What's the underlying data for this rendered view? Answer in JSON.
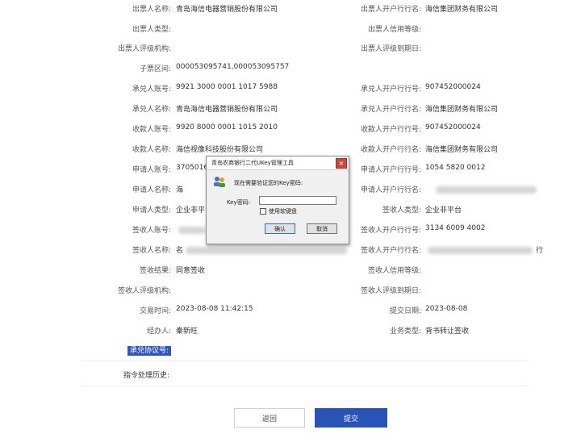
{
  "rows": [
    {
      "left_label": "出票人名称:",
      "left_value": "青岛海信电器营销股份有限公司",
      "right_label": "出票人开户行行名:",
      "right_value": "海信集团财务有限公司"
    },
    {
      "left_label": "出票人类型:",
      "left_value": "",
      "right_label": "出票人信用等级:",
      "right_value": ""
    },
    {
      "left_label": "出票人评级机构:",
      "left_value": "",
      "right_label": "出票人评级到期日:",
      "right_value": ""
    },
    {
      "left_label": "子票区间:",
      "left_value": "000053095741,000053095757",
      "right_label": "",
      "right_value": ""
    },
    {
      "left_label": "承兑人账号:",
      "left_value": "9921 3000 0001 1017 5988",
      "right_label": "承兑人开户行行号:",
      "right_value": "907452000024"
    },
    {
      "left_label": "承兑人名称:",
      "left_value": "青岛海信电器营销股份有限公司",
      "right_label": "承兑人开户行行名:",
      "right_value": "海信集团财务有限公司"
    },
    {
      "left_label": "收款人账号:",
      "left_value": "9920 8000 0001 1015 2010",
      "right_label": "收款人开户行行号:",
      "right_value": "907452000024"
    },
    {
      "left_label": "收款人名称:",
      "left_value": "海信视像科技股份有限公司",
      "right_label": "收款人开户行行名:",
      "right_value": "海信集团财务有限公司"
    },
    {
      "left_label": "申请人账号:",
      "left_value": "37050167",
      "right_label": "申请人开户行行号:",
      "right_value": "1054 5820 0012"
    },
    {
      "left_label": "申请人名称:",
      "left_value": "海",
      "right_label": "申请人开户行行名:",
      "right_value": ""
    },
    {
      "left_label": "申请人类型:",
      "left_value": "企业非平台",
      "right_label": "签收人类型:",
      "right_value": "企业非平台"
    },
    {
      "left_label": "签收人账号:",
      "left_value": "",
      "right_label": "签收人开户行行号:",
      "right_value": "3134 6009 4002"
    },
    {
      "left_label": "签收人名称:",
      "left_value": "名",
      "right_label": "签收人开户行行名:",
      "right_value": "行"
    },
    {
      "left_label": "签收结果:",
      "left_value": "同意签收",
      "right_label": "签收人信用等级:",
      "right_value": ""
    },
    {
      "left_label": "签收人评级机构:",
      "left_value": "",
      "right_label": "签收人评级到期日:",
      "right_value": ""
    },
    {
      "left_label": "交易时间:",
      "left_value": "2023-08-08 11:42:15",
      "right_label": "提交日期:",
      "right_value": "2023-08-08"
    },
    {
      "left_label": "经办人:",
      "left_value": "秦新旺",
      "right_label": "业务类型:",
      "right_value": "背书转让签收"
    },
    {
      "left_label": "承兑协议号:",
      "left_value": "",
      "right_label": "",
      "right_value": ""
    }
  ],
  "history": {
    "label": "指令处理历史:"
  },
  "dialog": {
    "title": "青岛农商银行二代UKey管理工具",
    "close": "×",
    "prompt": "现在需要验证您的Key密码:",
    "key_label": "Key密码:",
    "input_value": "",
    "checkbox_label": "使用软键盘",
    "ok_label": "确认",
    "cancel_label": "取消"
  },
  "footer": {
    "back_label": "返回",
    "submit_label": "提交"
  }
}
